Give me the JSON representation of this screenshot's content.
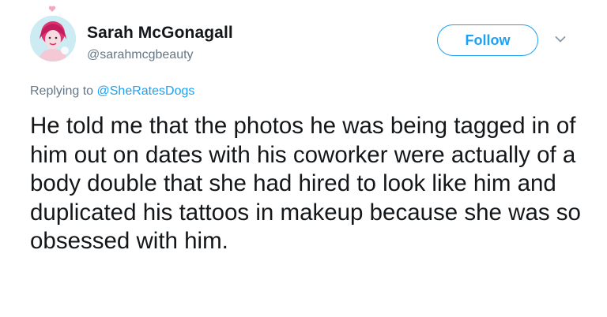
{
  "tweet": {
    "author": {
      "display_name": "Sarah McGonagall",
      "handle": "@sarahmcgbeauty",
      "avatar": "avatar"
    },
    "follow_label": "Follow",
    "menu_icon": "chevron-down-icon",
    "reply": {
      "prefix": "Replying to",
      "target": "@SheRatesDogs"
    },
    "text": "He told me that the photos he was being tagged in of him out on dates with his coworker were actually of a body double that she had hired to look like him and duplicated his tattoos in makeup because she was so obsessed with him.",
    "colors": {
      "accent": "#1da1f2",
      "secondary_text": "#657786",
      "primary_text": "#14171a"
    }
  }
}
